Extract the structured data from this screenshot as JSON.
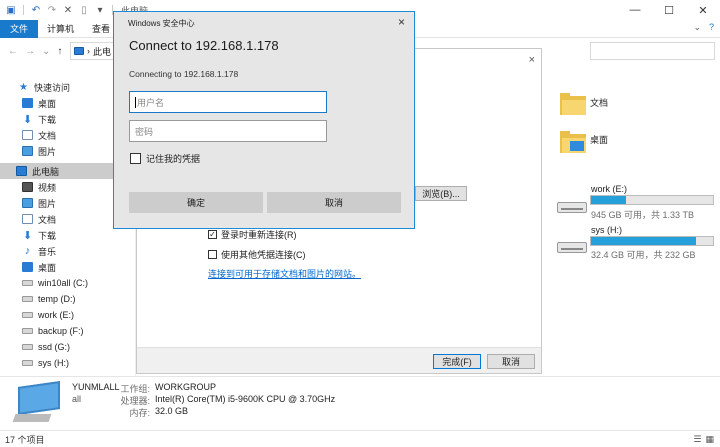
{
  "window": {
    "title": "此电脑",
    "controls": {
      "minimize": "—",
      "maximize": "☐",
      "close": "✕"
    }
  },
  "ribbon": {
    "tabs": [
      "文件",
      "计算机",
      "查看"
    ],
    "right": [
      "⌄",
      "?"
    ]
  },
  "address": {
    "nav": {
      "back": "←",
      "forward": "→",
      "recent": "⌄",
      "up": "↑"
    },
    "crumb": "此电",
    "chevron": "›"
  },
  "sidebar": {
    "items": [
      {
        "label": "快速访问"
      },
      {
        "label": "桌面"
      },
      {
        "label": "下载"
      },
      {
        "label": "文档"
      },
      {
        "label": "图片"
      },
      {
        "label": "此电脑"
      },
      {
        "label": "视频"
      },
      {
        "label": "图片"
      },
      {
        "label": "文档"
      },
      {
        "label": "下载"
      },
      {
        "label": "音乐"
      },
      {
        "label": "桌面"
      },
      {
        "label": "win10all (C:)"
      },
      {
        "label": "temp (D:)"
      },
      {
        "label": "work (E:)"
      },
      {
        "label": "backup (F:)"
      },
      {
        "label": "ssd (G:)"
      },
      {
        "label": "sys (H:)"
      }
    ]
  },
  "content": {
    "folders": [
      {
        "label": "文档"
      },
      {
        "label": "桌面"
      }
    ],
    "drives": [
      {
        "name": "work (E:)",
        "detail": "945 GB 可用，共 1.33 TB",
        "used_fraction": 0.29
      },
      {
        "name": "sys (H:)",
        "detail": "32.4 GB 可用，共 232 GB",
        "used_fraction": 0.86
      }
    ]
  },
  "map_dialog": {
    "browse_button": "浏览(B)...",
    "reconnect_label": "登录时重新连接(R)",
    "reconnect_checked": "✓",
    "other_cred_label": "使用其他凭据连接(C)",
    "link": "连接到可用于存储文档和图片的网站。",
    "finish_button": "完成(F)",
    "cancel_button": "取消",
    "close": "×"
  },
  "security_dialog": {
    "title": "Windows 安全中心",
    "heading": "Connect to 192.168.1.178",
    "subtitle": "Connecting to 192.168.1.178",
    "username_placeholder": "用户名",
    "password_placeholder": "密码",
    "remember_label": "记住我的凭据",
    "ok_button": "确定",
    "cancel_button": "取消",
    "close": "×"
  },
  "details": {
    "name": "YUNMLALL",
    "sub": "all",
    "rows": [
      {
        "label": "工作组:",
        "value": "WORKGROUP"
      },
      {
        "label": "处理器:",
        "value": "Intel(R) Core(TM) i5-9600K CPU @ 3.70GHz"
      },
      {
        "label": "内存:",
        "value": "32.0 GB"
      }
    ]
  },
  "status": {
    "text": "17 个项目"
  },
  "colors": {
    "accent": "#1979ca",
    "drive_bar": "#26a0da",
    "dialog_bg": "#e6e6e6"
  }
}
